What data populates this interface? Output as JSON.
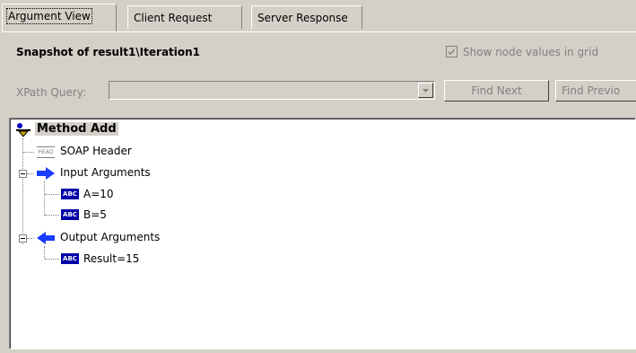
{
  "tabs": [
    {
      "label": "Argument View"
    },
    {
      "label": "Client Request"
    },
    {
      "label": "Server Response"
    }
  ],
  "snapshot_title": "Snapshot of result1\\Iteration1",
  "show_node_values": {
    "label": "Show node values in grid",
    "checked": true
  },
  "xpath": {
    "label": "XPath Query:",
    "value": ""
  },
  "buttons": {
    "find_next": "Find Next",
    "find_previous": "Find Previo"
  },
  "tree": {
    "root": "Method Add",
    "soap_header": "SOAP Header",
    "input": {
      "label": "Input Arguments",
      "args": [
        "A=10",
        "B=5"
      ]
    },
    "output": {
      "label": "Output Arguments",
      "args": [
        "Result=15"
      ]
    },
    "icons": {
      "abc": "ABC",
      "head": "HEAD"
    }
  }
}
